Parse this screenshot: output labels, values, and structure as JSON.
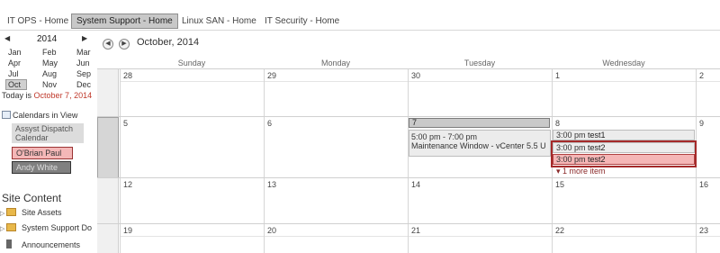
{
  "tabs": [
    {
      "label": "IT OPS - Home"
    },
    {
      "label": "System Support - Home"
    },
    {
      "label": "Linux SAN - Home"
    },
    {
      "label": "IT Security - Home"
    }
  ],
  "date_picker": {
    "year": "2014",
    "months": [
      "Jan",
      "Feb",
      "Mar",
      "Apr",
      "May",
      "Jun",
      "Jul",
      "Aug",
      "Sep",
      "Oct",
      "Nov",
      "Dec"
    ],
    "selected_month": "Oct",
    "today_label": "Today is",
    "today_date": "October 7, 2014"
  },
  "calendars_in_view": {
    "title": "Calendars in View",
    "items": [
      {
        "label": "Assyst Dispatch Calendar"
      },
      {
        "label": "O'Brian Paul"
      },
      {
        "label": "Andy White"
      }
    ]
  },
  "site_content": {
    "title": "Site Content",
    "items": [
      {
        "label": "Site Assets"
      },
      {
        "label": "System Support Do"
      },
      {
        "label": "Announcements"
      }
    ]
  },
  "calendar": {
    "month_title": "October, 2014",
    "day_names": [
      "Sunday",
      "Monday",
      "Tuesday",
      "Wednesday"
    ],
    "weeks": [
      {
        "days": [
          "28",
          "29",
          "30",
          "1",
          "2"
        ]
      },
      {
        "days": [
          "5",
          "6",
          "7",
          "8",
          "9"
        ]
      },
      {
        "days": [
          "12",
          "13",
          "14",
          "15",
          "16"
        ]
      },
      {
        "days": [
          "19",
          "20",
          "21",
          "22",
          "23"
        ]
      }
    ],
    "events": {
      "maintenance": {
        "time": "5:00 pm - 7:00 pm",
        "title": "Maintenance Window - vCenter 5.5 U"
      },
      "test1": {
        "time": "3:00 pm",
        "title": "test1"
      },
      "test2a": {
        "time": "3:00 pm",
        "title": "test2"
      },
      "test2b": {
        "time": "3:00 pm",
        "title": "test2"
      },
      "more": "1 more item"
    }
  },
  "colors": {
    "accent_red": "#a52a2a",
    "today_red": "#c0392b",
    "event_pink": "#f5b6b6"
  }
}
